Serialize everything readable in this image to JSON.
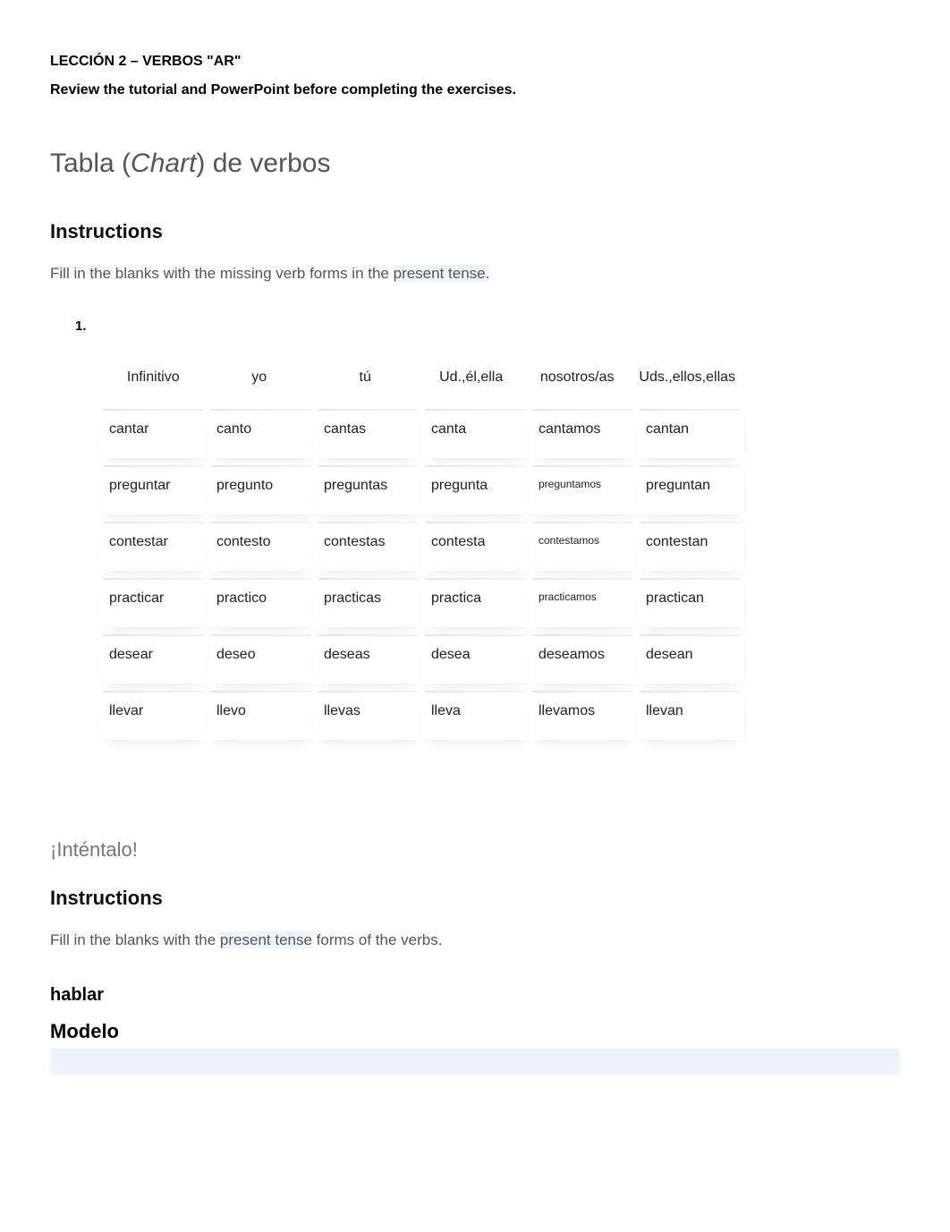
{
  "lesson": {
    "title": "LECCIÓN 2 – VERBOS \"AR\"",
    "review_note": "Review the tutorial and PowerPoint before completing the exercises."
  },
  "section1": {
    "heading_prefix": "Tabla (",
    "heading_italic": "Chart",
    "heading_suffix": ") de verbos",
    "instructions_label": "Instructions",
    "instructions_text": "Fill in the blanks with the missing verb forms in the ",
    "instructions_highlight": "present tense.",
    "list_number": "1."
  },
  "table": {
    "headers": [
      "Infinitivo",
      "yo",
      "tú",
      "Ud.,él,ella",
      "nosotros/as",
      "Uds.,ellos,ellas"
    ],
    "rows": [
      {
        "cells": [
          "cantar",
          "canto",
          "cantas",
          "canta",
          "cantamos",
          "cantan"
        ],
        "small": []
      },
      {
        "cells": [
          "preguntar",
          "pregunto",
          "preguntas",
          "pregunta",
          "preguntamos",
          "preguntan"
        ],
        "small": [
          4
        ]
      },
      {
        "cells": [
          "contestar",
          "contesto",
          "contestas",
          "contesta",
          "contestamos",
          "contestan"
        ],
        "small": [
          4
        ]
      },
      {
        "cells": [
          "practicar",
          "practico",
          "practicas",
          "practica",
          "practicamos",
          "practican"
        ],
        "small": [
          4
        ]
      },
      {
        "cells": [
          "desear",
          "deseo",
          "deseas",
          "desea",
          "deseamos",
          "desean"
        ],
        "small": []
      },
      {
        "cells": [
          "llevar",
          "llevo",
          "llevas",
          "lleva",
          "llevamos",
          "llevan"
        ],
        "small": []
      }
    ]
  },
  "section2": {
    "heading": "¡Inténtalo!",
    "instructions_label": "Instructions",
    "instructions_prefix": "Fill in the blanks with the ",
    "instructions_highlight": "present tense",
    "instructions_suffix": " forms of the verbs.",
    "verb": "hablar",
    "modelo": "Modelo"
  }
}
